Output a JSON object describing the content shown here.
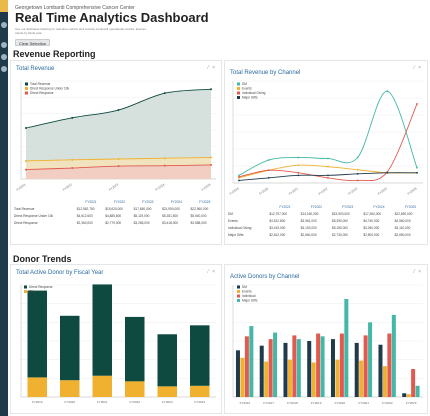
{
  "header": {
    "org": "Georgetown Lombardi Comprehensive Cancer Center",
    "title": "Real Time Analytics Dashboard",
    "description": "Use our dedicated tracking for real-time metrics and concise Lombardi operational metrics. Explore trends by fiscal year.",
    "button_label": "Clear Selection"
  },
  "sections": {
    "revenue": "Revenue Reporting",
    "donor": "Donor Trends"
  },
  "cards": {
    "total_revenue": "Total Revenue",
    "revenue_by_channel": "Total Revenue by Channel",
    "active_donor": "Total Active Donor by Fiscal Year",
    "donors_by_channel": "Active Donors by Channel",
    "controls": "⁄ ×"
  },
  "colors": {
    "accent": "#e9b949",
    "nav": "#1f3a4a",
    "title_blue": "#2b6aa0",
    "dark_green": "#0e4a3f",
    "teal": "#44b7a6",
    "orange": "#efb12f",
    "red": "#e05a4f",
    "navy": "#1f3a4a"
  },
  "tables": {
    "fy_headers": [
      "FY2021",
      "FY2022",
      "FY2023",
      "FY2024",
      "FY2025"
    ],
    "total_revenue_rows": [
      {
        "label": "Total Revenue",
        "values": [
          "$12,962,750",
          "$15,620,000",
          "$17,650,000",
          "$21,950,000",
          "$22,960,000"
        ]
      },
      {
        "label": "Direct Response Under 10k",
        "values": [
          "$4,612,600",
          "$4,885,800",
          "$5,119,000",
          "$5,281,500",
          "$5,540,000"
        ]
      },
      {
        "label": "Direct Response",
        "values": [
          "$2,360,000",
          "$2,779,000",
          "$3,265,000",
          "$3,418,000",
          "$3,588,000"
        ]
      }
    ],
    "channel_rows": [
      {
        "label": "DM",
        "values": [
          "$12,797,000",
          "$14,160,000",
          "$15,900,000",
          "$17,360,000",
          "$22,690,000"
        ]
      },
      {
        "label": "Events",
        "values": [
          "$4,512,800",
          "$3,961,000",
          "$5,390,000",
          "$4,740,000",
          "$4,560,000"
        ]
      },
      {
        "label": "Individual Giving",
        "values": [
          "$3,415,000",
          "$4,103,000",
          "$5,180,000",
          "$3,260,000",
          "$3,110,000"
        ]
      },
      {
        "label": "Major Gifts",
        "values": [
          "$2,612,000",
          "$2,660,000",
          "$2,730,000",
          "$2,500,000",
          "$2,650,000"
        ]
      }
    ]
  },
  "chart_data": [
    {
      "type": "area",
      "title": "Total Revenue",
      "categories": [
        "FY2021",
        "FY2022",
        "FY2023",
        "FY2024",
        "FY2025"
      ],
      "ylim": [
        0,
        25
      ],
      "grid": true,
      "legend": "top-left",
      "series": [
        {
          "name": "Total Revenue",
          "values": [
            13.0,
            15.6,
            17.6,
            21.9,
            22.9
          ],
          "color": "#0e4a3f"
        },
        {
          "name": "Direct Response Under 10k",
          "values": [
            4.6,
            4.9,
            5.1,
            5.3,
            5.5
          ],
          "color": "#efb12f"
        },
        {
          "name": "Direct Response",
          "values": [
            2.4,
            2.8,
            3.3,
            3.4,
            3.6
          ],
          "color": "#e05a4f"
        }
      ]
    },
    {
      "type": "line",
      "title": "Total Revenue by Channel",
      "categories": [
        "FY2019",
        "FY2020",
        "FY2021",
        "FY2022",
        "FY2023",
        "FY2024",
        "FY2025"
      ],
      "ylim": [
        0,
        20
      ],
      "grid": true,
      "legend": "top-left",
      "series": [
        {
          "name": "DM",
          "values": [
            1.5,
            4.5,
            5.0,
            4.8,
            5.0,
            18.0,
            3.0
          ],
          "color": "#44b7a6"
        },
        {
          "name": "Events",
          "values": [
            1.0,
            2.5,
            3.5,
            3.2,
            2.6,
            2.0,
            2.0
          ],
          "color": "#efb12f"
        },
        {
          "name": "Individual Giving",
          "values": [
            1.2,
            2.5,
            2.0,
            1.0,
            0.5,
            2.2,
            15.5
          ],
          "color": "#e05a4f"
        },
        {
          "name": "Major Gifts",
          "values": [
            0.5,
            1.0,
            1.5,
            1.5,
            1.8,
            2.0,
            2.0
          ],
          "color": "#1f3a4a"
        }
      ]
    },
    {
      "type": "bar",
      "title": "Total Active Donor by Fiscal Year",
      "stacked": true,
      "categories": [
        "FY2019",
        "FY2020",
        "FY2021",
        "FY2022",
        "FY2023",
        "FY2024"
      ],
      "ylim": [
        0,
        20000
      ],
      "legend": "top-left",
      "series": [
        {
          "name": "Direct Response",
          "values": [
            15500,
            11500,
            16300,
            11500,
            9300,
            10800
          ],
          "color": "#0e4a3f"
        },
        {
          "name": "Other",
          "values": [
            3500,
            3000,
            3800,
            2800,
            1900,
            2000
          ],
          "color": "#efb12f"
        }
      ]
    },
    {
      "type": "bar",
      "title": "Active Donors by Channel",
      "categories": [
        "FY2016",
        "FY2017",
        "FY2018",
        "FY2019",
        "FY2020",
        "FY2021",
        "FY2022",
        "FY2023"
      ],
      "ylim": [
        0,
        12000
      ],
      "legend": "top-left",
      "series": [
        {
          "name": "DM",
          "values": [
            5000,
            5500,
            5800,
            6000,
            6200,
            5800,
            5600,
            400
          ],
          "color": "#1f3a4a"
        },
        {
          "name": "Events",
          "values": [
            4200,
            3800,
            4000,
            3700,
            4000,
            3900,
            3300,
            300
          ],
          "color": "#efb12f"
        },
        {
          "name": "Individual",
          "values": [
            6500,
            6200,
            6600,
            6800,
            6800,
            6600,
            6800,
            3000
          ],
          "color": "#e05a4f"
        },
        {
          "name": "Major Gifts",
          "values": [
            7600,
            6900,
            6200,
            6500,
            10500,
            8000,
            8800,
            1200
          ],
          "color": "#44b7a6"
        }
      ]
    }
  ]
}
